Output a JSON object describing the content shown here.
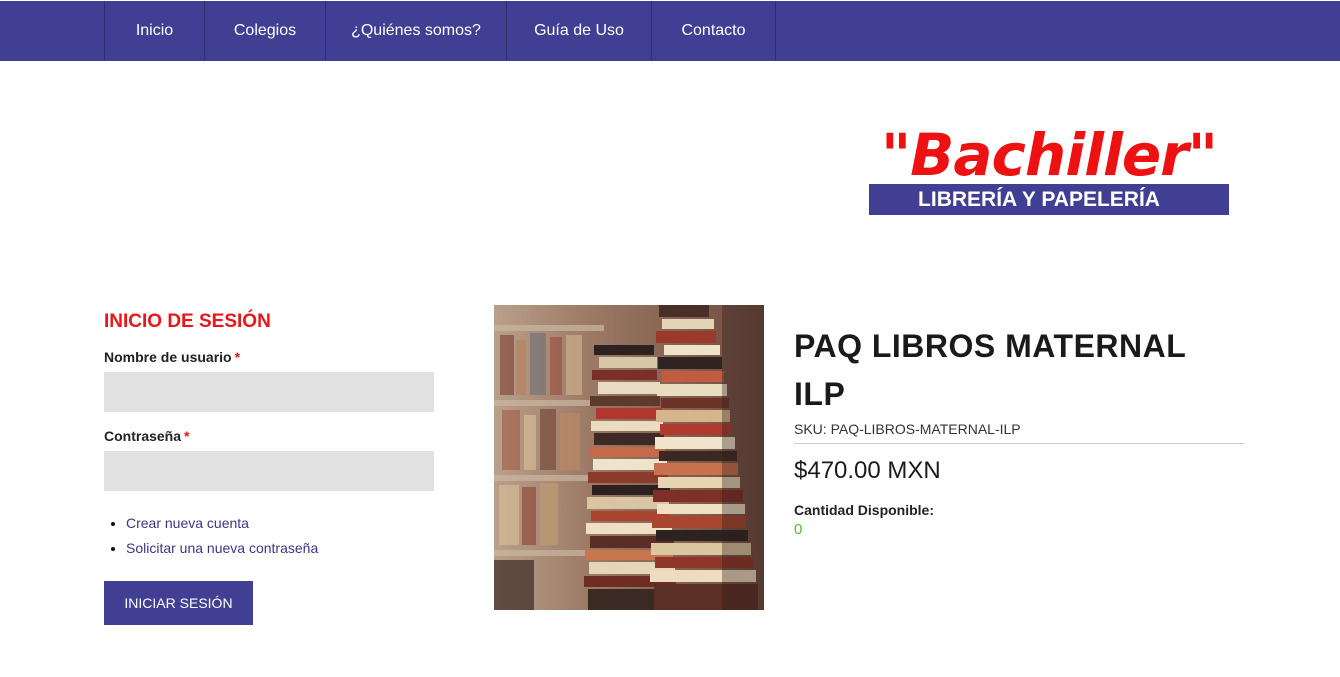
{
  "nav": {
    "items": [
      {
        "label": "Inicio"
      },
      {
        "label": "Colegios"
      },
      {
        "label": "¿Quiénes somos?"
      },
      {
        "label": "Guía de Uso"
      },
      {
        "label": "Contacto"
      }
    ]
  },
  "logo": {
    "title": "\"Bachiller\"",
    "subtitle": "LIBRERÍA Y PAPELERÍA"
  },
  "login": {
    "title": "INICIO DE SESIÓN",
    "username_label": "Nombre de usuario",
    "password_label": "Contraseña",
    "required_mark": "*",
    "links": [
      {
        "label": "Crear nueva cuenta"
      },
      {
        "label": "Solicitar una nueva contraseña"
      }
    ],
    "submit_label": "INICIAR SESIÓN"
  },
  "product": {
    "title": "PAQ LIBROS MATERNAL ILP",
    "sku": "SKU: PAQ-LIBROS-MATERNAL-ILP",
    "price": "$470.00 MXN",
    "stock_label": "Cantidad Disponible:",
    "stock_value": "0",
    "image_icon": "books-stack-photo"
  },
  "colors": {
    "brand": "#413f94",
    "accent": "#e8151b",
    "stock": "#5ab53e"
  }
}
